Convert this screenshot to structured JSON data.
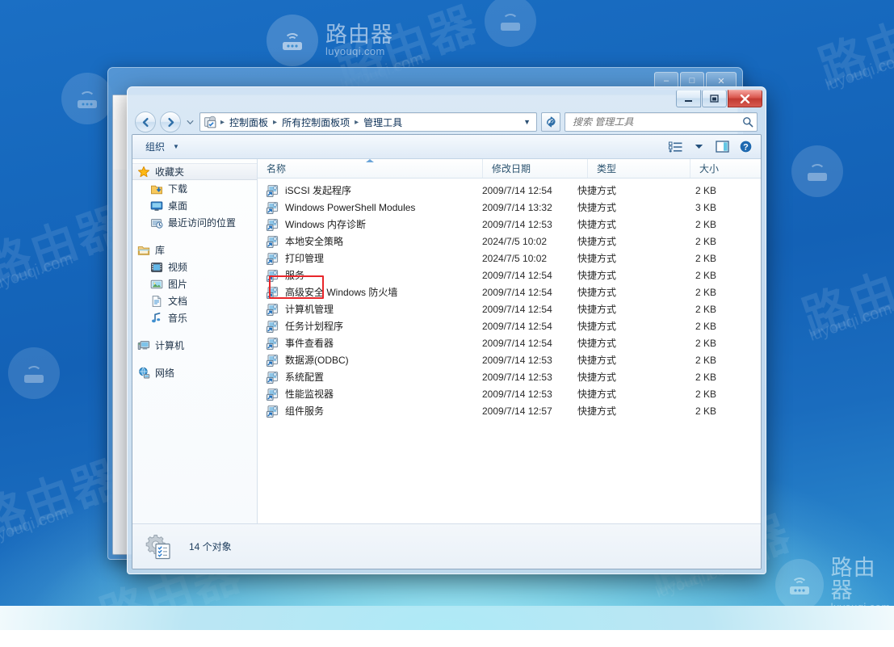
{
  "desktop": {
    "watermark": {
      "title": "路由器",
      "site": "luyouqi.com"
    }
  },
  "background_window": {
    "controls": {
      "minimize": "–",
      "maximize": "□",
      "close": "✕"
    }
  },
  "window": {
    "controls": {
      "minimize": "–",
      "maximize": "❐",
      "close": "✕"
    },
    "address": {
      "icon": "control-panel-icon",
      "crumbs": [
        "控制面板",
        "所有控制面板项",
        "管理工具"
      ],
      "separator": "▸",
      "dropdown_caret": "▼"
    },
    "search": {
      "placeholder": "搜索 管理工具",
      "value": "",
      "icon": "search-icon"
    },
    "refresh": {
      "icon": "refresh-icon"
    },
    "back": {
      "icon": "back-arrow-icon"
    },
    "forward": {
      "icon": "forward-arrow-icon"
    },
    "recent_pages": {
      "icon": "chevron-down-icon"
    }
  },
  "toolbar": {
    "organize_label": "组织",
    "organize_caret": "▼",
    "view_icon": "view-list-icon",
    "view_caret": "▼",
    "preview_icon": "preview-pane-icon",
    "help_icon": "help-icon"
  },
  "sidebar": {
    "groups": [
      {
        "root": {
          "label": "收藏夹",
          "icon": "star-icon",
          "selected": true
        },
        "items": [
          {
            "label": "下载",
            "icon": "downloads-icon"
          },
          {
            "label": "桌面",
            "icon": "desktop-icon"
          },
          {
            "label": "最近访问的位置",
            "icon": "recent-places-icon"
          }
        ]
      },
      {
        "root": {
          "label": "库",
          "icon": "library-icon",
          "selected": false
        },
        "items": [
          {
            "label": "视频",
            "icon": "videos-icon"
          },
          {
            "label": "图片",
            "icon": "pictures-icon"
          },
          {
            "label": "文档",
            "icon": "documents-icon"
          },
          {
            "label": "音乐",
            "icon": "music-icon"
          }
        ]
      },
      {
        "root": {
          "label": "计算机",
          "icon": "computer-icon",
          "selected": false
        },
        "items": []
      },
      {
        "root": {
          "label": "网络",
          "icon": "network-icon",
          "selected": false
        },
        "items": []
      }
    ]
  },
  "file_list": {
    "columns": [
      "名称",
      "修改日期",
      "类型",
      "大小"
    ],
    "sorted_by": "名称",
    "sort_direction": "ascending",
    "rows": [
      {
        "name": "iSCSI 发起程序",
        "date": "2009/7/14 12:54",
        "type": "快捷方式",
        "size": "2 KB",
        "icon": "shortcut-icon"
      },
      {
        "name": "Windows PowerShell Modules",
        "date": "2009/7/14 13:32",
        "type": "快捷方式",
        "size": "3 KB",
        "icon": "shortcut-icon"
      },
      {
        "name": "Windows 内存诊断",
        "date": "2009/7/14 12:53",
        "type": "快捷方式",
        "size": "2 KB",
        "icon": "shortcut-icon"
      },
      {
        "name": "本地安全策略",
        "date": "2024/7/5 10:02",
        "type": "快捷方式",
        "size": "2 KB",
        "icon": "shortcut-icon"
      },
      {
        "name": "打印管理",
        "date": "2024/7/5 10:02",
        "type": "快捷方式",
        "size": "2 KB",
        "icon": "shortcut-icon"
      },
      {
        "name": "服务",
        "date": "2009/7/14 12:54",
        "type": "快捷方式",
        "size": "2 KB",
        "icon": "shortcut-icon",
        "highlighted": true
      },
      {
        "name": "高级安全 Windows 防火墙",
        "date": "2009/7/14 12:54",
        "type": "快捷方式",
        "size": "2 KB",
        "icon": "shortcut-icon"
      },
      {
        "name": "计算机管理",
        "date": "2009/7/14 12:54",
        "type": "快捷方式",
        "size": "2 KB",
        "icon": "shortcut-icon"
      },
      {
        "name": "任务计划程序",
        "date": "2009/7/14 12:54",
        "type": "快捷方式",
        "size": "2 KB",
        "icon": "shortcut-icon"
      },
      {
        "name": "事件查看器",
        "date": "2009/7/14 12:54",
        "type": "快捷方式",
        "size": "2 KB",
        "icon": "shortcut-icon"
      },
      {
        "name": "数据源(ODBC)",
        "date": "2009/7/14 12:53",
        "type": "快捷方式",
        "size": "2 KB",
        "icon": "shortcut-icon"
      },
      {
        "name": "系统配置",
        "date": "2009/7/14 12:53",
        "type": "快捷方式",
        "size": "2 KB",
        "icon": "shortcut-icon"
      },
      {
        "name": "性能监视器",
        "date": "2009/7/14 12:53",
        "type": "快捷方式",
        "size": "2 KB",
        "icon": "shortcut-icon"
      },
      {
        "name": "组件服务",
        "date": "2009/7/14 12:57",
        "type": "快捷方式",
        "size": "2 KB",
        "icon": "shortcut-icon"
      }
    ]
  },
  "status_bar": {
    "icon": "admin-tools-icon",
    "text": "14 个对象"
  },
  "colors": {
    "annotation": "#e8262a",
    "desktop_blue": "#1668bd",
    "crumb_text": "#0a2e55"
  }
}
